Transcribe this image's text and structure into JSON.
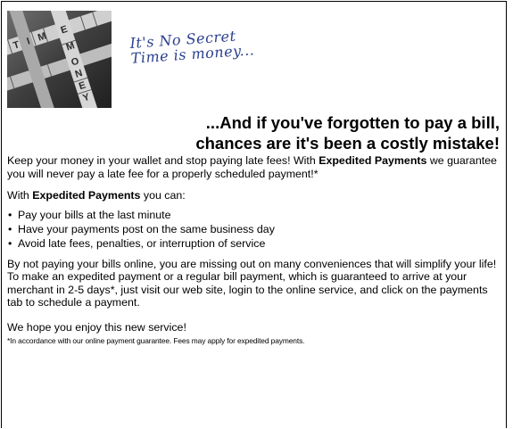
{
  "hero": {
    "image_name": "crossword-time-money",
    "letters_across": [
      "T",
      "I",
      "M",
      "E"
    ],
    "letters_down": [
      "M",
      "O",
      "N",
      "E",
      "Y"
    ]
  },
  "tagline": {
    "line1": "It's No Secret",
    "line2": "Time is money..."
  },
  "headline": {
    "line1": "...And if you've forgotten to pay a bill,",
    "line2": "chances are it's been a costly mistake!"
  },
  "intro": {
    "text_before": "Keep your money in your wallet and stop paying late fees! With ",
    "brand": "Expedited Payments",
    "text_after": " we guarantee you will never pay a late fee for a properly scheduled payment!*"
  },
  "can": {
    "prefix": "With ",
    "brand": "Expedited Payments",
    "suffix": " you can:"
  },
  "bullets": [
    "Pay your bills at the last minute",
    "Have your payments post on the same business day",
    "Avoid late fees, penalties, or interruption of service"
  ],
  "bullet_glyph": "•",
  "convenience": "By not paying your bills online, you are missing out on many conveniences that will simplify your life! To make an expedited payment or a regular bill payment, which is guaranteed to arrive at your merchant in 2-5 days*, just visit our web site, login to the online service, and click on the payments tab to schedule a payment.",
  "closing": "We hope you enjoy this new service!",
  "footnote": "*In accordance with our online payment guarantee. Fees may apply for expedited payments.",
  "colors": {
    "tagline": "#2a3f8f"
  }
}
